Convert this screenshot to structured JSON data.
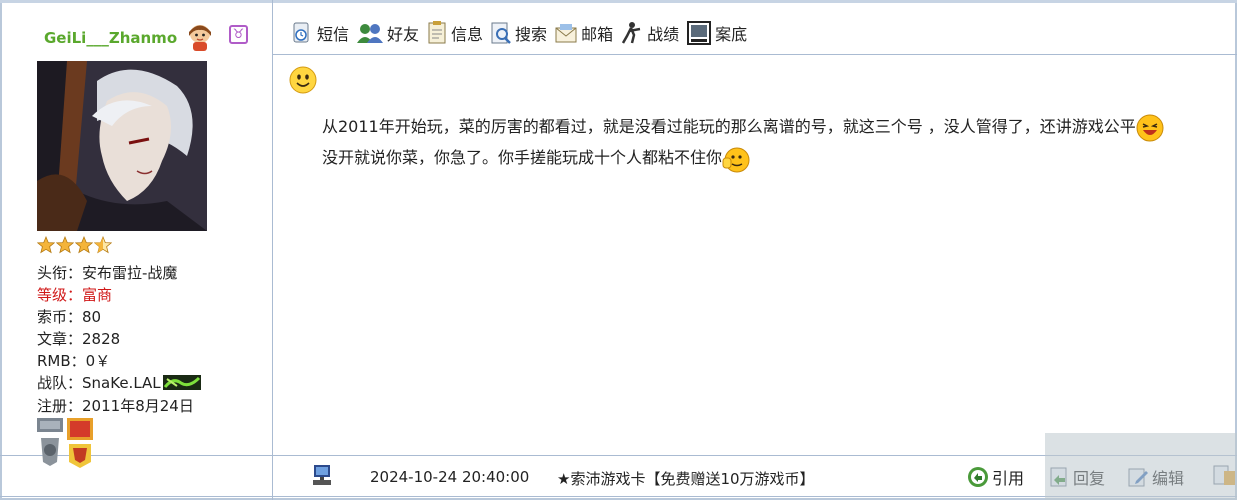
{
  "profile": {
    "username": "GeiLi___Zhanmo",
    "sign_symbol": "♉",
    "stars": 4,
    "title_label": "头衔：",
    "title_value": "安布雷拉-战魔",
    "level_label": "等级：",
    "level_value": "富商",
    "coins_label": "索币：",
    "coins_value": "80",
    "posts_label": "文章：",
    "posts_value": "2828",
    "rmb_label": "RMB：",
    "rmb_value": "0￥",
    "team_label": "战队：",
    "team_value": "SnaKe.LAL",
    "reg_label": "注册：",
    "reg_value": "2011年8月24日"
  },
  "toolbar": {
    "sms": "短信",
    "friends": "好友",
    "info": "信息",
    "search": "搜索",
    "mail": "邮箱",
    "record": "战绩",
    "archive": "案底"
  },
  "post": {
    "line1": "从2011年开始玩，菜的厉害的都看过，就是没看过能玩的那么离谱的号，就这三个号 ，没人管得了，还讲游戏公平",
    "line2": "没开就说你菜，你急了。你手搓能玩成十个人都粘不住你"
  },
  "footer": {
    "datetime": "2024-10-24 20:40:00",
    "ad": "★索沛游戏卡【免费赠送10万游戏币】",
    "quote": "引用",
    "reply": "回复",
    "edit": "编辑"
  },
  "colors": {
    "username": "#5aa82d",
    "level": "#d01818",
    "border": "#aabbd2"
  }
}
